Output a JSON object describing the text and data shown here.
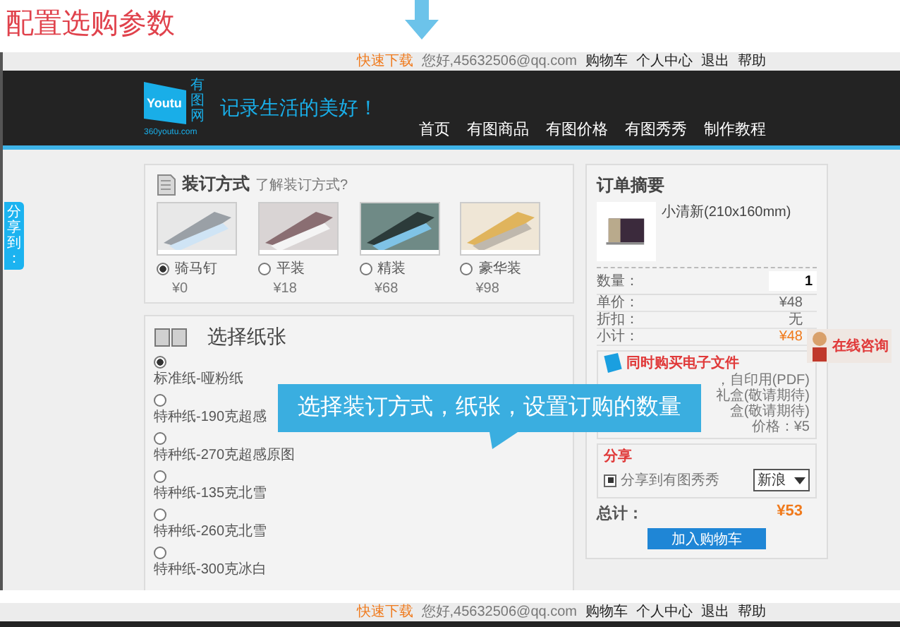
{
  "heading": "配置选购参数",
  "top_bar": {
    "links": [
      {
        "label": "快速下载",
        "kind": "highlight"
      },
      {
        "label": "您好,45632506@qq.com",
        "kind": "plain"
      },
      {
        "label": "购物车",
        "kind": "link"
      },
      {
        "label": "个人中心",
        "kind": "link"
      },
      {
        "label": "退出",
        "kind": "link"
      },
      {
        "label": "帮助",
        "kind": "link"
      }
    ]
  },
  "header": {
    "logo": {
      "name": "Youtu",
      "vertical": "有图网",
      "domain": "360youtu.com"
    },
    "slogan": "记录生活的美好！",
    "nav": [
      "首页",
      "有图商品",
      "有图价格",
      "有图秀秀",
      "制作教程"
    ]
  },
  "share_tab": "分享到：",
  "binding": {
    "title": "装订方式",
    "help_link": "了解装订方式?",
    "options": [
      {
        "label": "骑马钉",
        "price": "¥0",
        "selected": true
      },
      {
        "label": "平装",
        "price": "¥18",
        "selected": false
      },
      {
        "label": "精装",
        "price": "¥68",
        "selected": false
      },
      {
        "label": "豪华装",
        "price": "¥98",
        "selected": false
      }
    ]
  },
  "paper": {
    "title": "选择纸张",
    "options": [
      {
        "label": "标准纸-哑粉纸",
        "selected": true
      },
      {
        "label": "特种纸-190克超感",
        "selected": false
      },
      {
        "label": "特种纸-270克超感原图",
        "selected": false
      },
      {
        "label": "特种纸-135克北雪",
        "selected": false
      },
      {
        "label": "特种纸-260克北雪",
        "selected": false
      },
      {
        "label": "特种纸-300克冰白",
        "selected": false
      }
    ]
  },
  "order": {
    "title": "订单摘要",
    "product": "小清新(210x160mm)",
    "quantity": {
      "label": "数量：",
      "value": "1"
    },
    "rows": [
      {
        "label": "单价：",
        "value": "¥48",
        "kind": "plain"
      },
      {
        "label": "折扣：",
        "value": "无",
        "kind": "plain"
      },
      {
        "label": "小计：",
        "value": "¥48",
        "kind": "highlight"
      }
    ],
    "ebook": {
      "title": "同时购买电子文件",
      "lines": [
        "，自印用(PDF)",
        "礼盒(敬请期待)",
        "盒(敬请期待)"
      ],
      "price": "价格：¥5"
    },
    "share": {
      "title": "分享",
      "label": "分享到有图秀秀",
      "checked": true,
      "select": "新浪"
    },
    "total": {
      "label": "总计：",
      "value": "¥53"
    },
    "button": "加入购物车"
  },
  "online_chat": "在线咨询",
  "callout": "选择装订方式，纸张，设置订购的数量",
  "repeat_bar": {
    "links": [
      {
        "label": "快速下载",
        "kind": "highlight"
      },
      {
        "label": "您好,45632506@qq.com",
        "kind": "plain"
      },
      {
        "label": "购物车",
        "kind": "link"
      },
      {
        "label": "个人中心",
        "kind": "link"
      },
      {
        "label": "退出",
        "kind": "link"
      },
      {
        "label": "帮助",
        "kind": "link"
      }
    ]
  }
}
